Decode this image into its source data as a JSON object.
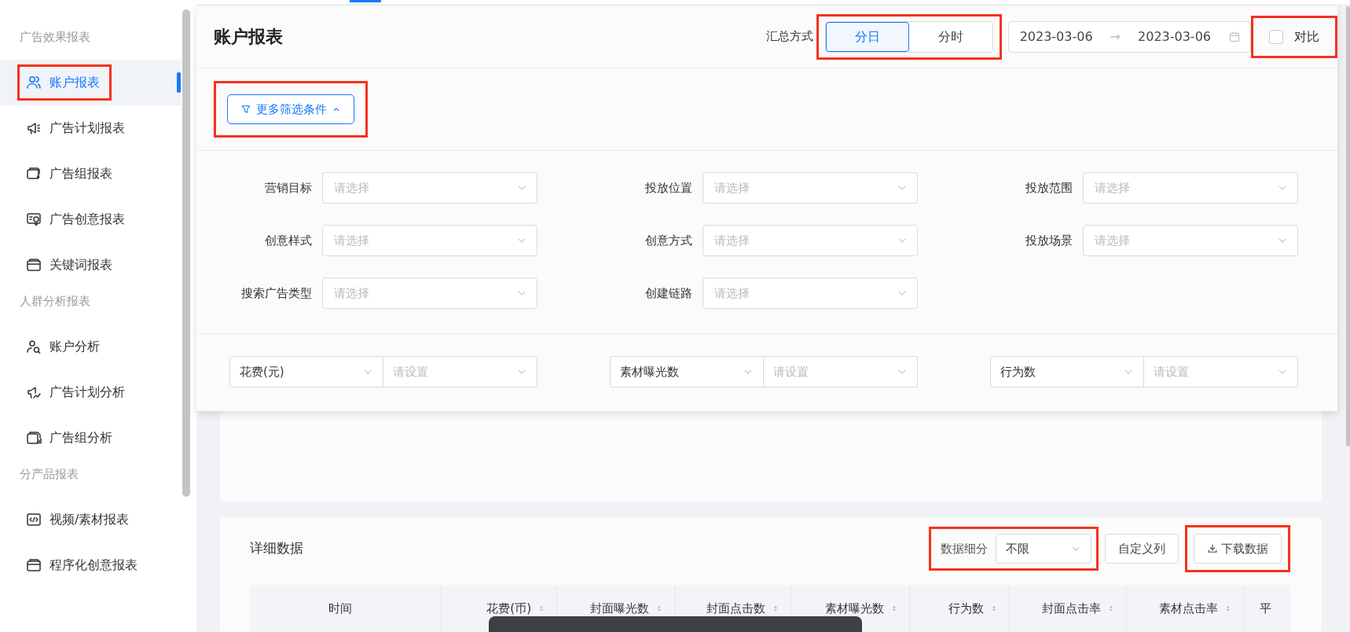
{
  "sidebar": {
    "groups": [
      {
        "title": "广告效果报表",
        "items": [
          {
            "label": "账户报表",
            "selected": true,
            "highlighted": true
          },
          {
            "label": "广告计划报表",
            "selected": false,
            "highlighted": false
          },
          {
            "label": "广告组报表",
            "selected": false,
            "highlighted": false
          },
          {
            "label": "广告创意报表",
            "selected": false,
            "highlighted": false
          },
          {
            "label": "关键词报表",
            "selected": false,
            "highlighted": false
          }
        ]
      },
      {
        "title": "人群分析报表",
        "items": [
          {
            "label": "账户分析",
            "selected": false,
            "highlighted": false
          },
          {
            "label": "广告计划分析",
            "selected": false,
            "highlighted": false
          },
          {
            "label": "广告组分析",
            "selected": false,
            "highlighted": false
          }
        ]
      },
      {
        "title": "分产品报表",
        "items": [
          {
            "label": "视频/素材报表",
            "selected": false,
            "highlighted": false
          },
          {
            "label": "程序化创意报表",
            "selected": false,
            "highlighted": false
          }
        ]
      }
    ]
  },
  "header": {
    "title": "账户报表",
    "summary_label": "汇总方式",
    "summary_highlighted": true,
    "summary_options": [
      {
        "label": "分日",
        "selected": true
      },
      {
        "label": "分时",
        "selected": false
      }
    ],
    "date_start": "2023-03-06",
    "date_arrow": "→",
    "date_end": "2023-03-06",
    "compare": {
      "label": "对比",
      "checked": false,
      "highlighted": true
    }
  },
  "filter_toggle": {
    "label": "更多筛选条件",
    "expanded": true,
    "highlighted": true
  },
  "filters": [
    {
      "label": "营销目标",
      "placeholder": "请选择"
    },
    {
      "label": "投放位置",
      "placeholder": "请选择"
    },
    {
      "label": "投放范围",
      "placeholder": "请选择"
    },
    {
      "label": "创意样式",
      "placeholder": "请选择"
    },
    {
      "label": "创意方式",
      "placeholder": "请选择"
    },
    {
      "label": "投放场景",
      "placeholder": "请选择"
    },
    {
      "label": "搜索广告类型",
      "placeholder": "请选择"
    },
    {
      "label": "创建链路",
      "placeholder": "请选择"
    }
  ],
  "metric_filters": [
    {
      "metric": "花费(元)",
      "placeholder": "请设置"
    },
    {
      "metric": "素材曝光数",
      "placeholder": "请设置"
    },
    {
      "metric": "行为数",
      "placeholder": "请设置"
    }
  ],
  "detail": {
    "title": "详细数据",
    "breakdown": {
      "label": "数据细分",
      "value": "不限",
      "highlighted": true
    },
    "custom_columns": "自定义列",
    "download": {
      "label": "下载数据",
      "highlighted": true
    },
    "columns": [
      {
        "label": "时间",
        "sortable": false
      },
      {
        "label": "花费(币)",
        "sortable": true
      },
      {
        "label": "封面曝光数",
        "sortable": true
      },
      {
        "label": "封面点击数",
        "sortable": true
      },
      {
        "label": "素材曝光数",
        "sortable": true
      },
      {
        "label": "行为数",
        "sortable": true
      },
      {
        "label": "封面点击率",
        "sortable": true
      },
      {
        "label": "素材点击率",
        "sortable": true
      },
      {
        "label": "平",
        "sortable": false
      }
    ]
  }
}
